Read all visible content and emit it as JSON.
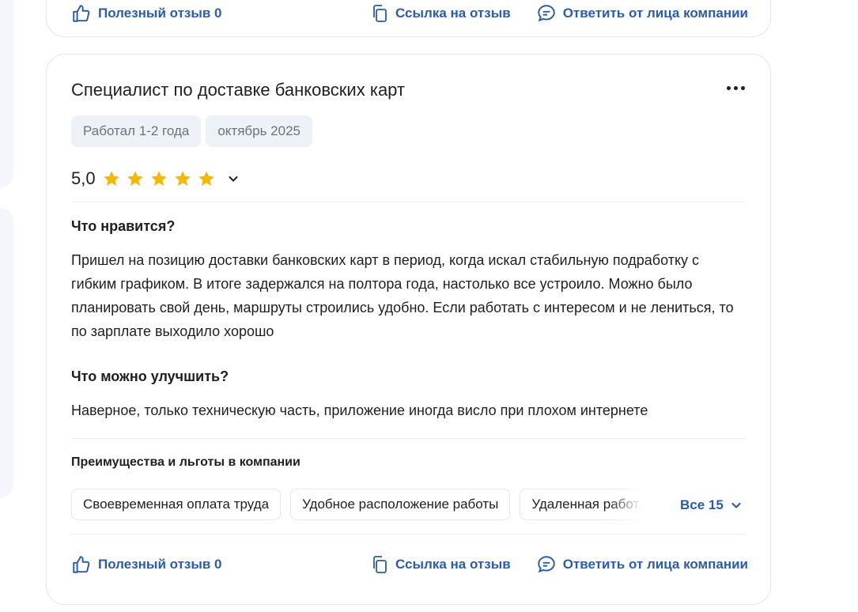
{
  "previous_review": {
    "useful_label": "Полезный отзыв 0",
    "link_label": "Ссылка на отзыв",
    "reply_label": "Ответить от лица компании"
  },
  "review": {
    "title": "Специалист по доставке банковских карт",
    "tags": [
      "Работал 1-2 года",
      "октябрь 2025"
    ],
    "rating": "5,0",
    "stars": 5,
    "likes_title": "Что нравится?",
    "likes_text": "Пришел на позицию доставки банковских карт в период, когда искал стабильную подработку с гибким графиком. В итоге задержался на полтора года, настолько все устроило. Можно было планировать свой день, маршруты строились удобно. Если работать с интересом и не лениться, то по зарплате выходило хорошо",
    "improve_title": "Что можно улучшить?",
    "improve_text": "Наверное, только техническую часть, приложение иногда висло при плохом интернете",
    "benefits_title": "Преимущества и льготы в компании",
    "benefits": [
      "Своевременная оплата труда",
      "Удобное расположение работы",
      "Удаленная работа"
    ],
    "all_benefits_label": "Все 15",
    "useful_label": "Полезный отзыв 0",
    "link_label": "Ссылка на отзыв",
    "reply_label": "Ответить от лица компании"
  },
  "colors": {
    "accent": "#2a5ca8",
    "star": "#f5b800",
    "tag_bg": "#eef1f6",
    "border": "#e3e6ec"
  },
  "icons": [
    "thumbs-up-icon",
    "copy-link-icon",
    "chat-bubble-icon",
    "more-dots-icon",
    "star-icon",
    "chevron-down-icon"
  ]
}
